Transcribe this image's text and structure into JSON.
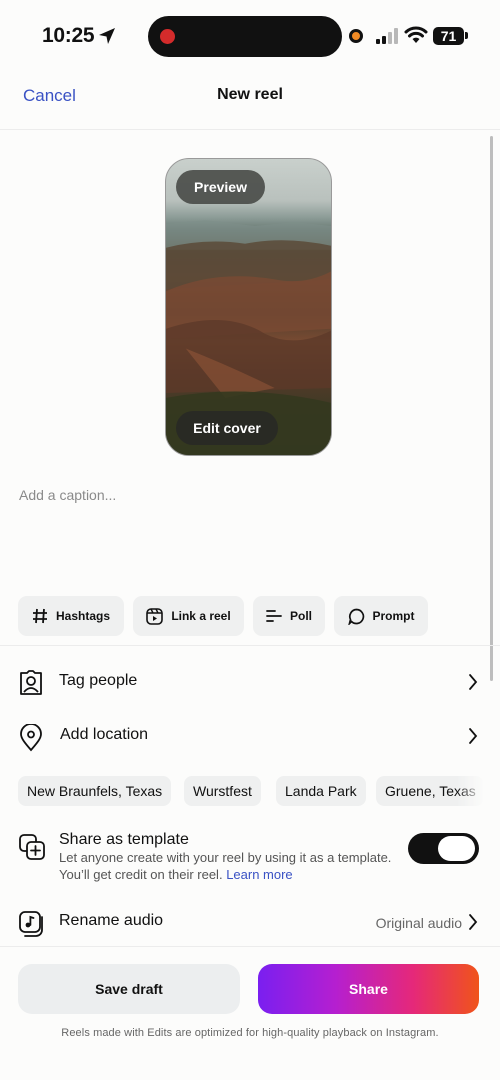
{
  "status_bar": {
    "time": "10:25",
    "battery": "71",
    "icons": [
      "location-arrow-icon",
      "recording-dot-icon",
      "camera-in-use-icon",
      "cellular-signal-icon",
      "wifi-icon",
      "battery-icon"
    ]
  },
  "nav": {
    "cancel_label": "Cancel",
    "title": "New reel"
  },
  "preview": {
    "preview_label": "Preview",
    "edit_cover_label": "Edit cover"
  },
  "caption": {
    "placeholder": "Add a caption..."
  },
  "chips": [
    {
      "label": "Hashtags",
      "icon": "hashtag-icon"
    },
    {
      "label": "Link a reel",
      "icon": "reel-link-icon"
    },
    {
      "label": "Poll",
      "icon": "poll-icon"
    },
    {
      "label": "Prompt",
      "icon": "prompt-bubble-icon"
    }
  ],
  "rows": {
    "tag_people": "Tag people",
    "add_location": "Add location",
    "rename_audio": "Rename audio",
    "audio_value": "Original audio"
  },
  "location_suggestions": [
    "New Braunfels, Texas",
    "Wurstfest",
    "Landa Park",
    "Gruene, Texas"
  ],
  "template": {
    "title": "Share as template",
    "description": "Let anyone create with your reel by using it as a template. You’ll get credit on their reel.",
    "learn_more": "Learn more",
    "enabled": true
  },
  "actions": {
    "save_draft": "Save draft",
    "share": "Share"
  },
  "footnote": "Reels made with Edits are optimized for high-quality playback on Instagram.",
  "colors": {
    "link_blue": "#3a52c4",
    "share_gradient": [
      "#7a1ff0",
      "#e5287a",
      "#f0541a"
    ],
    "background": "#fcfcfb"
  }
}
